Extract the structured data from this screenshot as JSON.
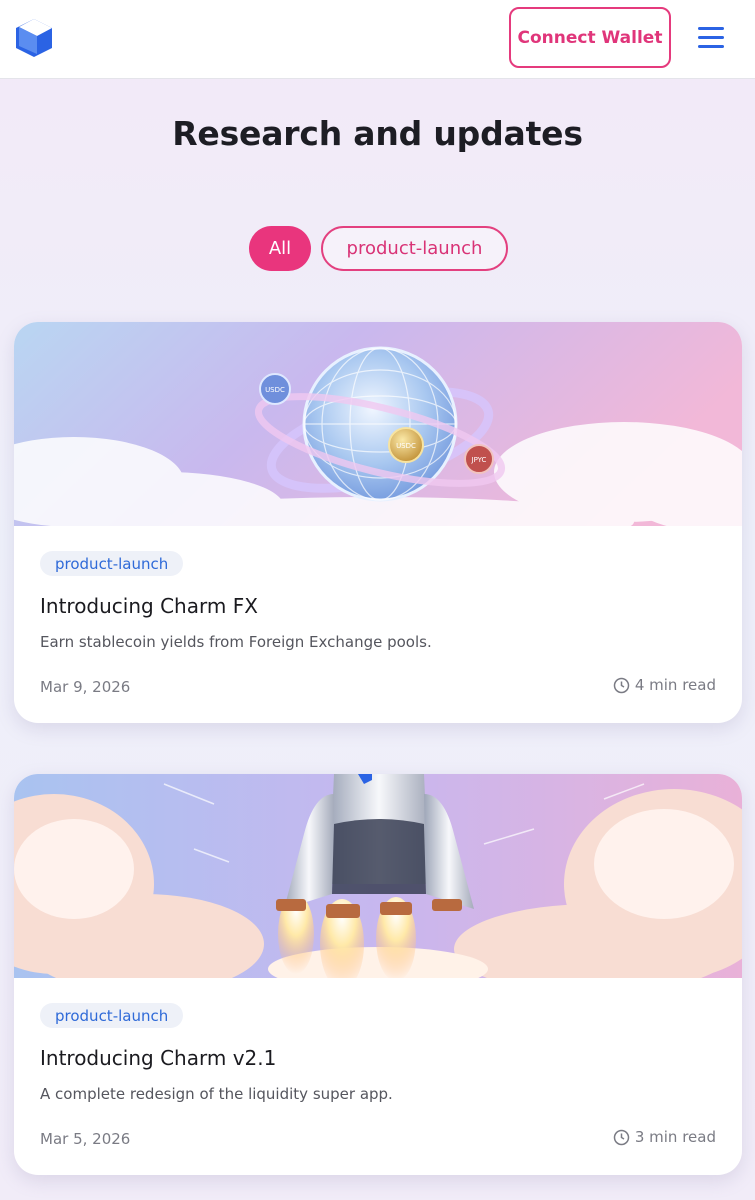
{
  "header": {
    "connect_label": "Connect Wallet",
    "brand_color": "#2b63e4",
    "accent_color": "#e9357d"
  },
  "page": {
    "title": "Research and updates"
  },
  "filters": [
    {
      "label": "All",
      "active": true
    },
    {
      "label": "product-launch",
      "active": false
    }
  ],
  "posts": [
    {
      "tag": "product-launch",
      "title": "Introducing Charm FX",
      "description": "Earn stablecoin yields from Foreign Exchange pools.",
      "date": "Mar 9, 2026",
      "read_time": "4 min read",
      "coin_labels": [
        "USDC",
        "USDC",
        "JPYC"
      ]
    },
    {
      "tag": "product-launch",
      "title": "Introducing Charm v2.1",
      "description": "A complete redesign of the liquidity super app.",
      "date": "Mar 5, 2026",
      "read_time": "3 min read"
    }
  ]
}
